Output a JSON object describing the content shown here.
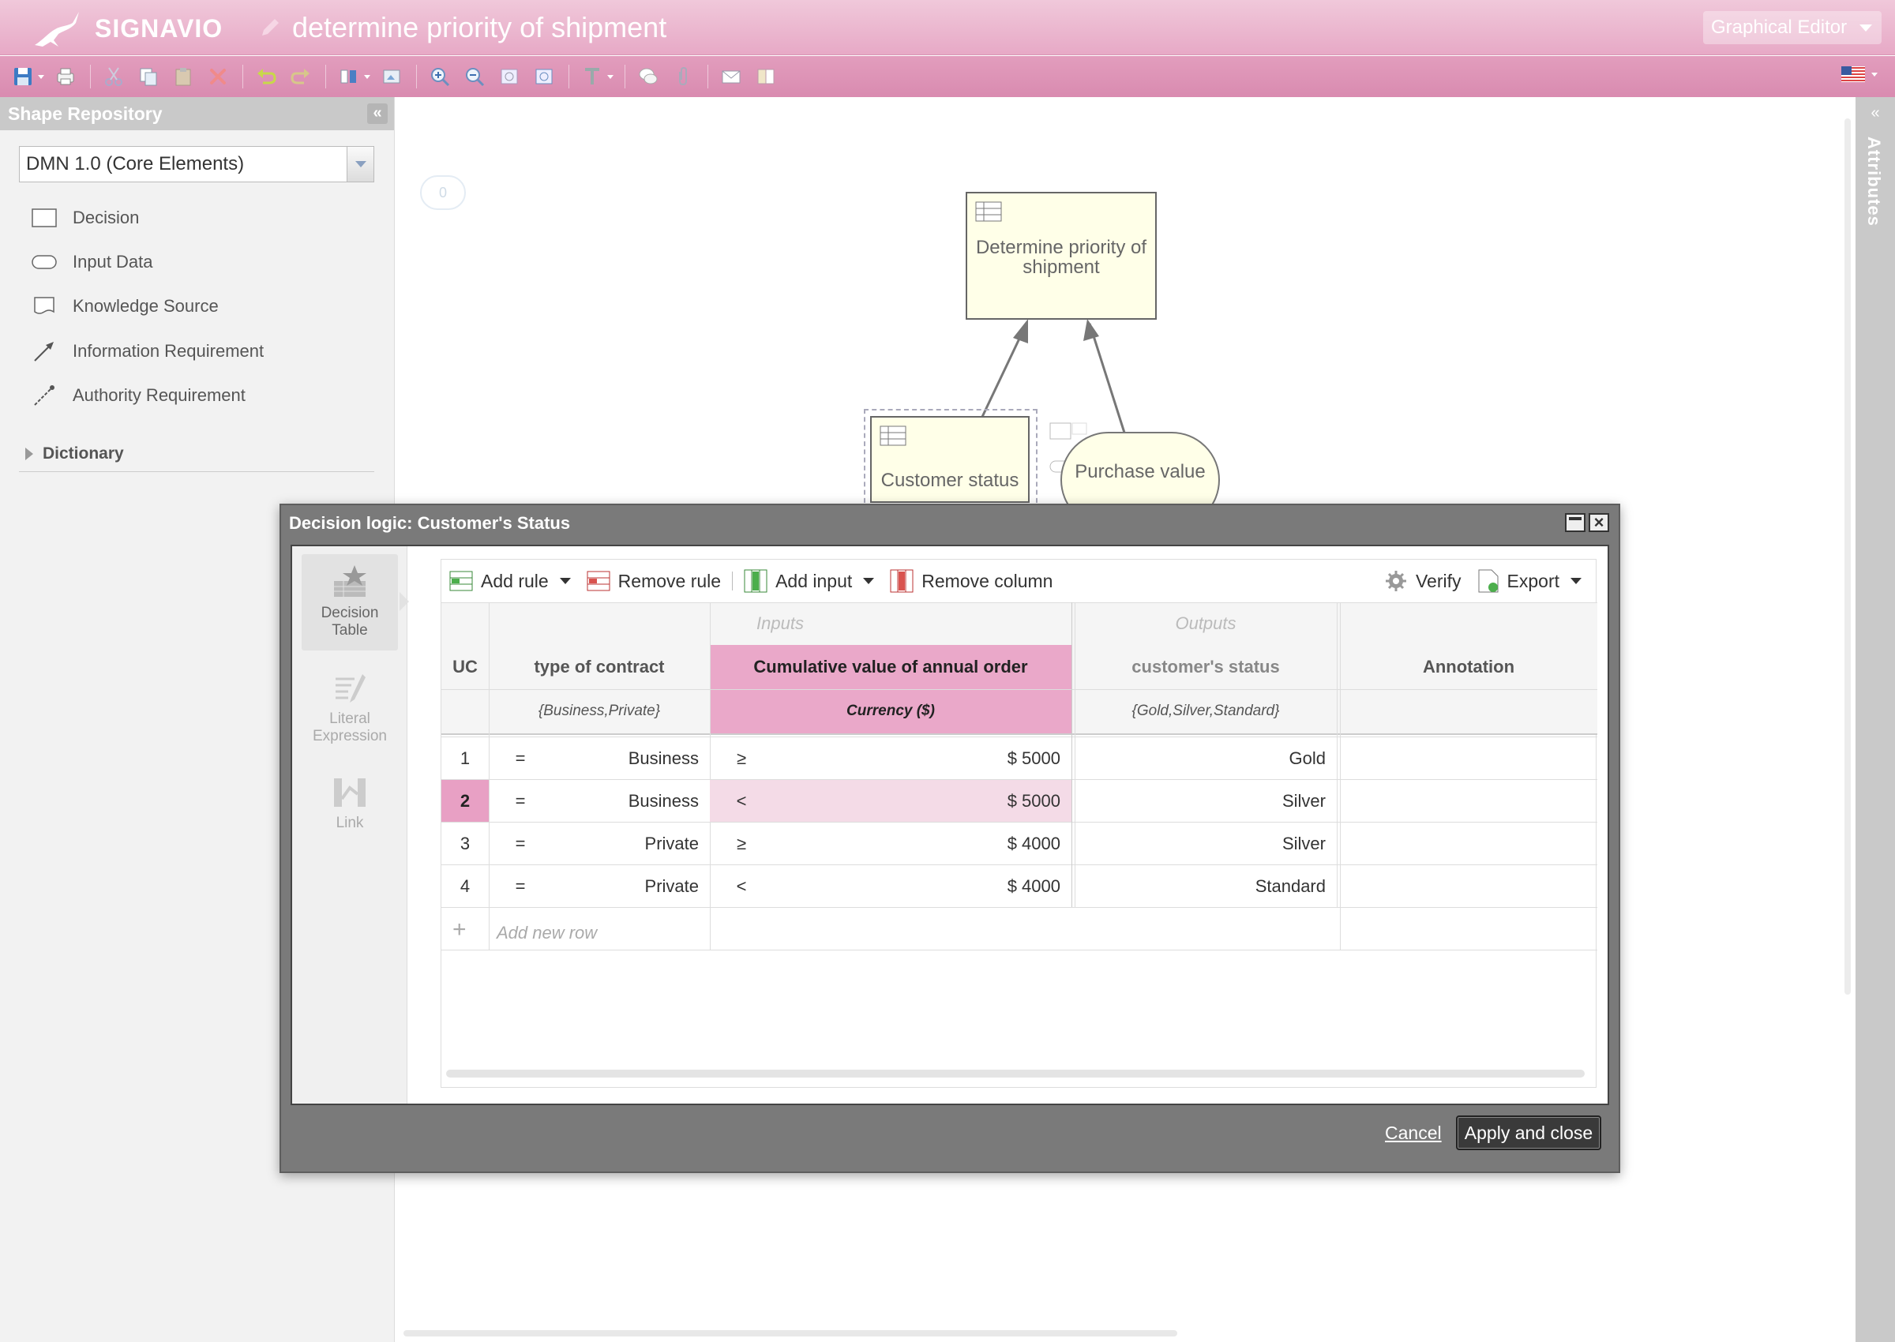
{
  "header": {
    "brand": "SIGNAVIO",
    "document_title": "determine priority of shipment",
    "editor_mode": "Graphical Editor"
  },
  "toolbar": {
    "icons": [
      "save-icon",
      "print-icon",
      "cut-icon",
      "copy-icon",
      "paste-icon",
      "delete-icon",
      "undo-icon",
      "redo-icon",
      "align-icon",
      "image-export-icon",
      "zoom-in-icon",
      "zoom-out-icon",
      "zoom-fit-icon",
      "zoom-actual-icon",
      "text-format-icon",
      "comment-icon",
      "attachment-icon",
      "mail-icon",
      "dictionary-book-icon",
      "language-flag-icon"
    ]
  },
  "left_panel": {
    "title": "Shape Repository",
    "stencil_set": "DMN 1.0 (Core Elements)",
    "shapes": [
      {
        "label": "Decision",
        "icon": "decision-shape-icon"
      },
      {
        "label": "Input Data",
        "icon": "input-data-shape-icon"
      },
      {
        "label": "Knowledge Source",
        "icon": "knowledge-source-shape-icon"
      },
      {
        "label": "Information Requirement",
        "icon": "information-requirement-icon"
      },
      {
        "label": "Authority Requirement",
        "icon": "authority-requirement-icon"
      }
    ],
    "dictionary": "Dictionary"
  },
  "right_panel": {
    "title": "Attributes"
  },
  "canvas": {
    "comment_count": "0",
    "nodes": {
      "main_decision": "Determine priority of shipment",
      "customer_status": "Customer status",
      "purchase_value": "Purchase value"
    }
  },
  "modal": {
    "title": "Decision logic: Customer's Status",
    "modes": [
      {
        "label": "Decision Table",
        "active": true
      },
      {
        "label": "Literal Expression",
        "active": false
      },
      {
        "label": "Link",
        "active": false
      }
    ],
    "toolbar": {
      "add_rule": "Add rule",
      "remove_rule": "Remove rule",
      "add_input": "Add input",
      "remove_column": "Remove column",
      "verify": "Verify",
      "export": "Export"
    },
    "table": {
      "inputs_group": "Inputs",
      "outputs_group": "Outputs",
      "hit_policy": "UC",
      "columns": [
        {
          "name": "type of contract",
          "type": "{Business,Private}"
        },
        {
          "name": "Cumulative value of annual order",
          "type": "Currency ($)"
        },
        {
          "name": "customer's status",
          "type": "{Gold,Silver,Standard}"
        },
        {
          "name": "Annotation",
          "type": ""
        }
      ],
      "rows": [
        {
          "num": "1",
          "op1": "=",
          "contract": "Business",
          "op2": "≥",
          "value": "$ 5000",
          "status": "Gold",
          "annotation": ""
        },
        {
          "num": "2",
          "op1": "=",
          "contract": "Business",
          "op2": "<",
          "value": "$ 5000",
          "status": "Silver",
          "annotation": ""
        },
        {
          "num": "3",
          "op1": "=",
          "contract": "Private",
          "op2": "≥",
          "value": "$ 4000",
          "status": "Silver",
          "annotation": ""
        },
        {
          "num": "4",
          "op1": "=",
          "contract": "Private",
          "op2": "<",
          "value": "$ 4000",
          "status": "Standard",
          "annotation": ""
        }
      ],
      "selected_row": 2,
      "highlighted_column": "Cumulative value of annual order",
      "add_row_placeholder": "Add new row"
    },
    "footer": {
      "cancel": "Cancel",
      "apply": "Apply and close"
    }
  },
  "colors": {
    "header_pink": "#e7a9c6",
    "highlight_pink": "#eaa8c9",
    "node_fill": "#ffffe8",
    "modal_gray": "#7a7a7a"
  }
}
